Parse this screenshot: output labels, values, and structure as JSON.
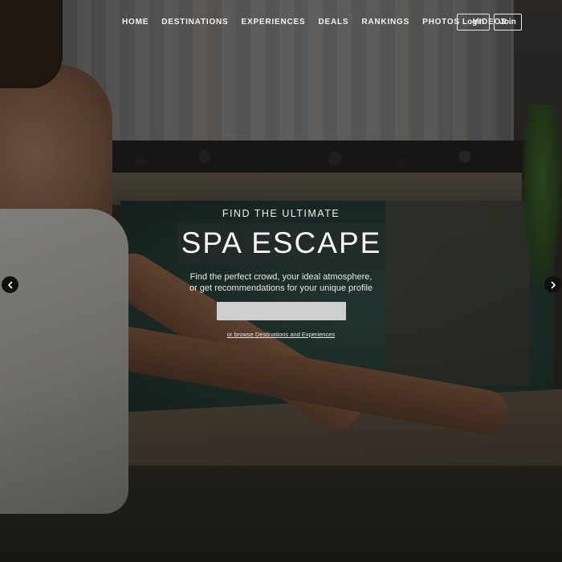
{
  "nav": {
    "items": [
      "HOME",
      "DESTINATIONS",
      "EXPERIENCES",
      "DEALS",
      "RANKINGS",
      "PHOTOS",
      "VIDEOS"
    ]
  },
  "auth": {
    "login_label": "Login",
    "join_label": "Join"
  },
  "hero": {
    "kicker": "FIND THE ULTIMATE",
    "headline": "SPA ESCAPE",
    "subline_1": "Find the perfect crowd, your ideal atmosphere,",
    "subline_2": "or get recommendations for your unique profile",
    "search_placeholder": "",
    "browse_link": "or browse Destinations and Experiences"
  },
  "carousel": {
    "prev_icon": "chevron-left-icon",
    "next_icon": "chevron-right-icon"
  }
}
